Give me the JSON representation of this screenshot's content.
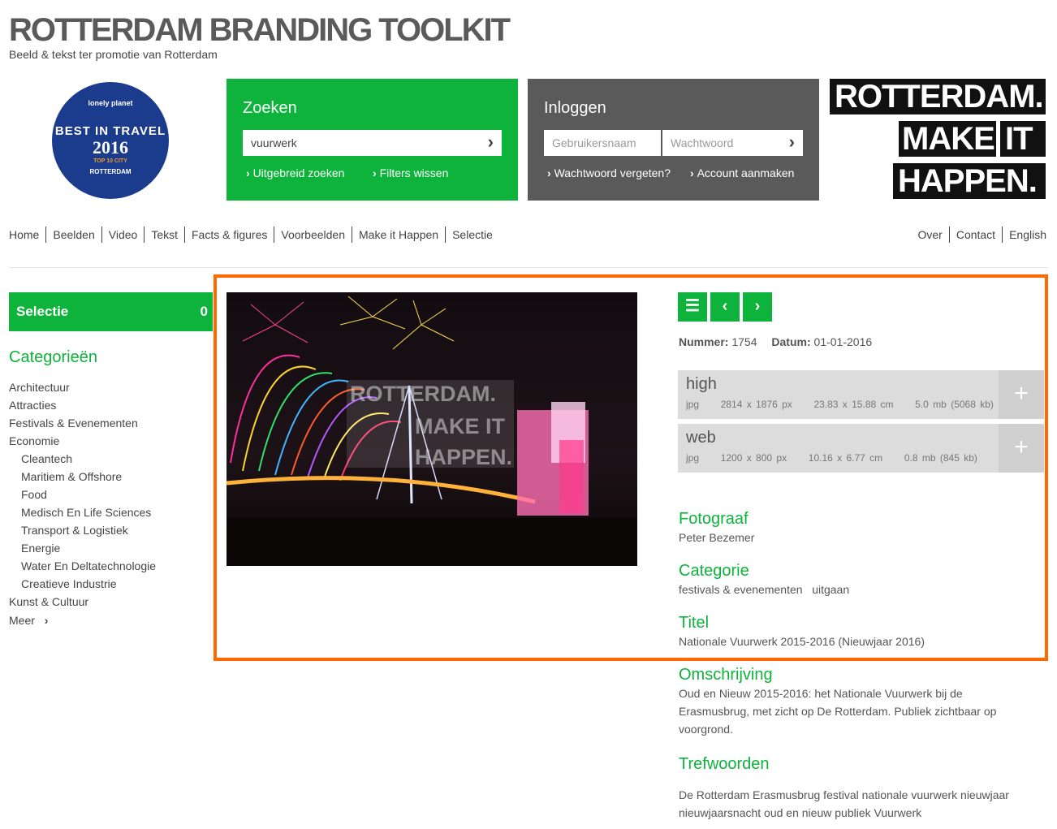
{
  "header": {
    "title": "ROTTERDAM BRANDING TOOLKIT",
    "subtitle": "Beeld & tekst ter promotie van Rotterdam"
  },
  "badge": {
    "brand": "lonely planet",
    "line1": "BEST IN TRAVEL",
    "year": "2016",
    "line2": "TOP 10 CITY",
    "city": "ROTTERDAM"
  },
  "search": {
    "heading": "Zoeken",
    "value": "vuurwerk",
    "advanced": "Uitgebreid zoeken",
    "clear": "Filters wissen"
  },
  "login": {
    "heading": "Inloggen",
    "username_placeholder": "Gebruikersnaam",
    "password_placeholder": "Wachtwoord",
    "forgot": "Wachtwoord vergeten?",
    "create": "Account aanmaken"
  },
  "logo": {
    "line1": "ROTTERDAM.",
    "line2a": "MAKE",
    "line2b": "IT",
    "line3": "HAPPEN."
  },
  "nav": {
    "left": [
      "Home",
      "Beelden",
      "Video",
      "Tekst",
      "Facts & figures",
      "Voorbeelden",
      "Make it Happen",
      "Selectie"
    ],
    "right": [
      "Over",
      "Contact",
      "English"
    ]
  },
  "sidebar": {
    "selectie_label": "Selectie",
    "selectie_count": "0",
    "categories_title": "Categorieën",
    "categories": [
      {
        "label": "Architectuur",
        "indent": false
      },
      {
        "label": "Attracties",
        "indent": false
      },
      {
        "label": "Festivals & Evenementen",
        "indent": false
      },
      {
        "label": "Economie",
        "indent": false
      },
      {
        "label": "Cleantech",
        "indent": true
      },
      {
        "label": "Maritiem & Offshore",
        "indent": true
      },
      {
        "label": "Food",
        "indent": true
      },
      {
        "label": "Medisch En Life Sciences",
        "indent": true
      },
      {
        "label": "Transport & Logistiek",
        "indent": true
      },
      {
        "label": "Energie",
        "indent": true
      },
      {
        "label": "Water En Deltatechnologie",
        "indent": true
      },
      {
        "label": "Creatieve Industrie",
        "indent": true
      },
      {
        "label": "Kunst & Cultuur",
        "indent": false
      }
    ],
    "more": "Meer"
  },
  "detail": {
    "nummer_label": "Nummer:",
    "nummer": "1754",
    "datum_label": "Datum:",
    "datum": "01-01-2016",
    "downloads": [
      {
        "title": "high",
        "format": "jpg",
        "px": "2814 x 1876 px",
        "cm": "23.83 x 15.88 cm",
        "size": "5.0 mb (5068 kb)"
      },
      {
        "title": "web",
        "format": "jpg",
        "px": "1200 x 800 px",
        "cm": "10.16 x 6.77 cm",
        "size": "0.8 mb (845 kb)"
      }
    ],
    "fotograaf_label": "Fotograaf",
    "fotograaf": "Peter Bezemer",
    "categorie_label": "Categorie",
    "categorie": "festivals & evenementen   uitgaan",
    "titel_label": "Titel",
    "titel": "Nationale Vuurwerk 2015-2016 (Nieuwjaar 2016)",
    "omschrijving_label": "Omschrijving",
    "omschrijving": "Oud en Nieuw 2015-2016: het Nationale Vuurwerk bij de Erasmusbrug, met zicht op De Rotterdam. Publiek zichtbaar op voorgrond.",
    "trefwoorden_label": "Trefwoorden",
    "trefwoorden": "De Rotterdam Erasmusbrug festival nationale vuurwerk nieuwjaar nieuwjaarsnacht oud en nieuw publiek Vuurwerk"
  },
  "watermark": {
    "line1": "ROTTERDAM.",
    "line2": "MAKE IT",
    "line3": "HAPPEN."
  },
  "colors": {
    "green": "#0db33b",
    "dark_gray": "#5a5a5a",
    "highlight": "#ff6a00"
  }
}
